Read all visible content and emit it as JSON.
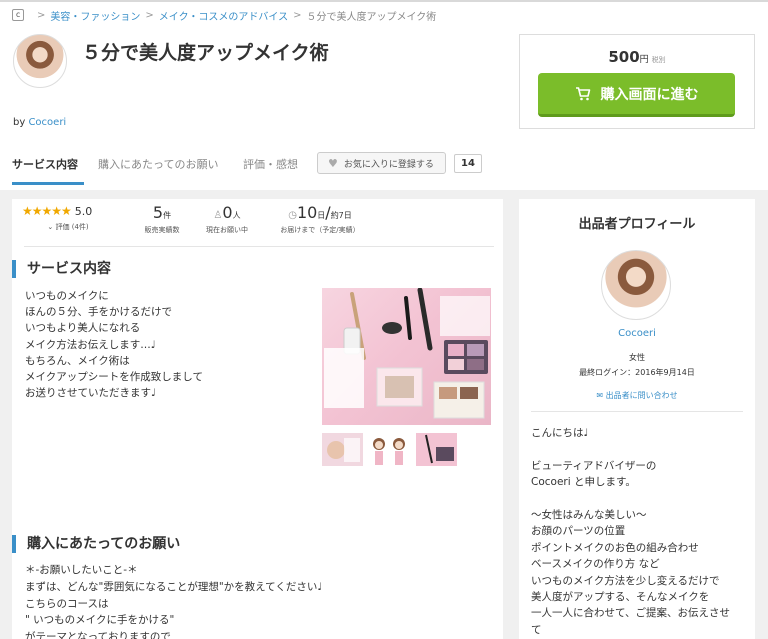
{
  "breadcrumb": {
    "logo": "c",
    "separator": ">",
    "items": [
      "美容・ファッション",
      "メイク・コスメのアドバイス",
      "５分で美人度アップメイク術"
    ]
  },
  "header": {
    "title": "５分で美人度アップメイク術",
    "by_label": "by",
    "seller_name": "Cocoeri"
  },
  "purchase": {
    "price": "500",
    "currency": "円",
    "tax_note": "税別",
    "buy_label": "購入画面に進む",
    "accent_color": "#7bbd2a"
  },
  "tabs": {
    "items": [
      "サービス内容",
      "購入にあたってのお願い",
      "評価・感想"
    ],
    "active_index": 0,
    "favorite_label": "お気に入りに登録する",
    "favorite_count": "14"
  },
  "stats": {
    "rating_stars": 5,
    "rating_value": "5.0",
    "rating_sub": "評価 (4件)",
    "sales_num": "5",
    "sales_unit": "件",
    "sales_label": "販売実績数",
    "pending_num": "0",
    "pending_unit": "人",
    "pending_label": "現在お願い中",
    "delivery_num": "10",
    "delivery_unit": "日",
    "delivery_slash": "/",
    "delivery_alt": "約7日",
    "delivery_label": "お届けまで（予定/実績）"
  },
  "service": {
    "heading": "サービス内容",
    "description": "いつものメイクに\nほんの５分、手をかけるだけで\nいつもより美人になれる\nメイク方法お伝えします…♩\nもちろん、メイク術は\nメイクアップシートを作成致しまして\nお送りさせていただきます♩"
  },
  "purchase_notes": {
    "heading": "購入にあたってのお願い",
    "text": "＊-お願いしたいこと-＊\nまずは、どんな\"雰囲気になることが理想\"かを教えてください♩\nこちらのコースは\n\" いつものメイクに手をかける\"\nがテーマとなっておりますので"
  },
  "profile": {
    "heading": "出品者プロフィール",
    "name": "Cocoeri",
    "gender": "女性",
    "last_login": "最終ログイン：2016年9月14日",
    "contact_label": "出品者に問い合わせ",
    "description": "こんにちは♩\n\nビューティアドバイザーの\nCocoeri と申します。\n\n～女性はみんな美しい～\nお顔のパーツの位置\nポイントメイクのお色の組み合わせ\nベースメイクの作り方 など\nいつものメイク方法を少し変えるだけで\n美人度がアップする、そんなメイクを\n一人一人に合わせて、ご提案、お伝えさせ\nて"
  },
  "colors": {
    "link": "#3a8fc8",
    "star": "#f0a800"
  }
}
